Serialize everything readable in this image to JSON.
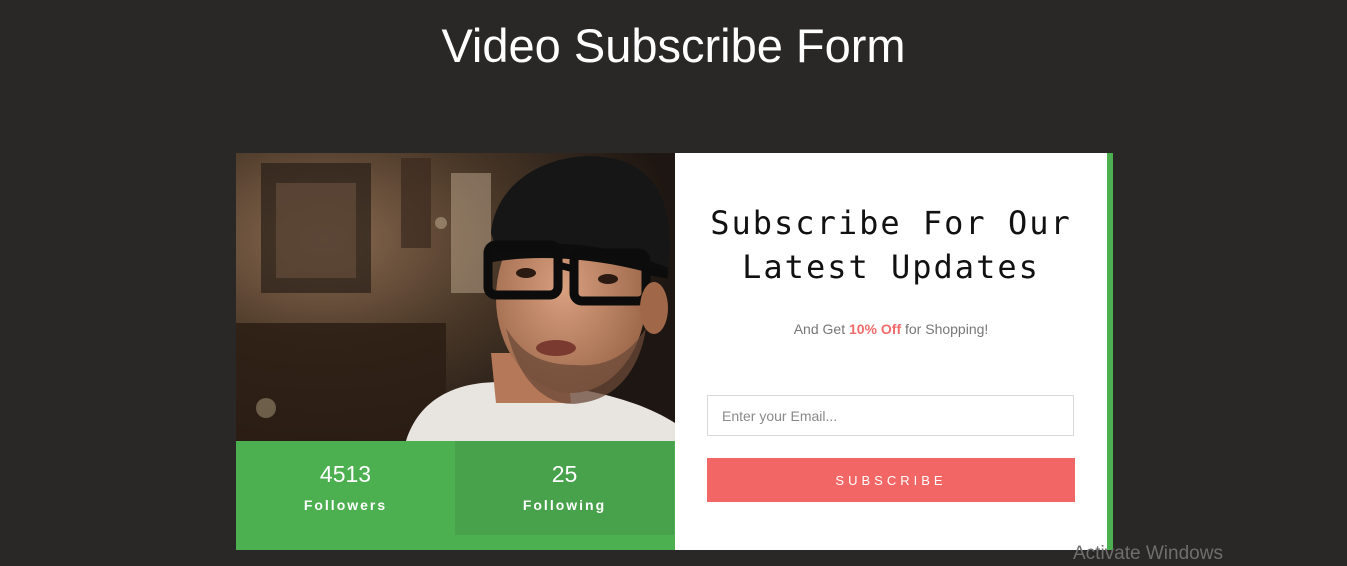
{
  "page": {
    "title": "Video Subscribe Form"
  },
  "video": {
    "description_icon": "video-thumbnail"
  },
  "stats": [
    {
      "value": "4513",
      "label": "Followers"
    },
    {
      "value": "25",
      "label": "Following"
    }
  ],
  "form": {
    "heading_line1": "Subscribe For Our",
    "heading_line2": "Latest Updates",
    "offer_prefix": "And Get ",
    "offer_highlight": "10% Off",
    "offer_suffix": " for Shopping!",
    "email_placeholder": "Enter your Email...",
    "email_value": "",
    "subscribe_label": "SUBSCRIBE"
  },
  "system": {
    "watermark": "Activate Windows"
  },
  "colors": {
    "background": "#2a2827",
    "green": "#4caf50",
    "green_dark": "#48a24c",
    "accent_red": "#f26666",
    "white": "#ffffff"
  }
}
